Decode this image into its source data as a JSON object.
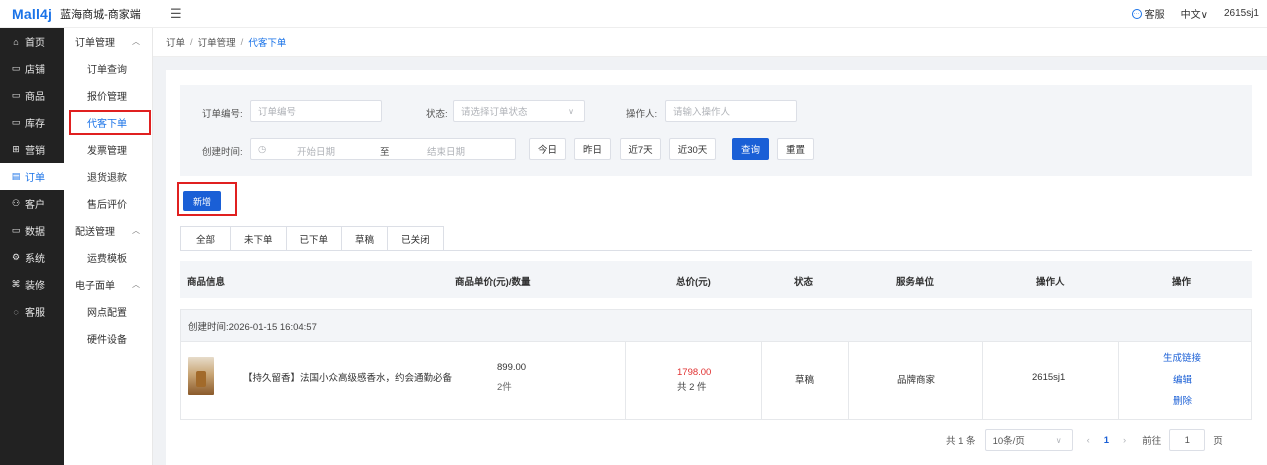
{
  "topbar": {
    "logo": "Mall4j",
    "app_title": "蓝海商城-商家端",
    "menu_toggle_icon": "menu-fold-icon",
    "service_label": "客服",
    "language_label": "中文∨",
    "user_name": "2615sj1"
  },
  "sidebar": {
    "items": [
      {
        "label": "首页",
        "icon": "home-icon"
      },
      {
        "label": "店铺",
        "icon": "shop-icon"
      },
      {
        "label": "商品",
        "icon": "goods-icon"
      },
      {
        "label": "库存",
        "icon": "stock-icon"
      },
      {
        "label": "营销",
        "icon": "gift-icon"
      },
      {
        "label": "订单",
        "icon": "order-icon"
      },
      {
        "label": "客户",
        "icon": "customer-icon"
      },
      {
        "label": "数据",
        "icon": "data-icon"
      },
      {
        "label": "系统",
        "icon": "system-icon"
      },
      {
        "label": "装修",
        "icon": "decorate-icon"
      },
      {
        "label": "客服",
        "icon": "chat-icon"
      }
    ],
    "glyphs": [
      "⌂",
      "▭",
      "▭",
      "▭",
      "⊞",
      "▤",
      "⚇",
      "▭",
      "⚙",
      "⌘",
      "◌"
    ]
  },
  "submenu": {
    "group1": "订单管理",
    "items1": [
      "订单查询",
      "报价管理",
      "代客下单",
      "发票管理",
      "退货退款",
      "售后评价"
    ],
    "group2": "配送管理",
    "items2": [
      "运费模板"
    ],
    "group3": "电子面单",
    "items3": [
      "网点配置",
      "硬件设备"
    ]
  },
  "breadcrumb": {
    "level1": "订单",
    "level2": "订单管理",
    "current": "代客下单",
    "separator": "/"
  },
  "filter": {
    "order_no_label": "订单编号:",
    "order_no_placeholder": "订单编号",
    "status_label": "状态:",
    "status_placeholder": "请选择订单状态",
    "operator_label": "操作人:",
    "operator_placeholder": "请输入操作人",
    "created_label": "创建时间:",
    "start_placeholder": "开始日期",
    "range_sep": "至",
    "end_placeholder": "结束日期",
    "quick_buttons": [
      "今日",
      "昨日",
      "近7天",
      "近30天"
    ],
    "search_button": "查询",
    "reset_button": "重置"
  },
  "actions": {
    "new_button": "新增"
  },
  "tabs": [
    "全部",
    "未下单",
    "已下单",
    "草稿",
    "已关闭"
  ],
  "table": {
    "headers": [
      "商品信息",
      "商品单价(元)/数量",
      "总价(元)",
      "状态",
      "服务单位",
      "操作人",
      "操作"
    ]
  },
  "order": {
    "created": "创建时间:2026-01-15 16:04:57",
    "product_name": "【持久留香】法国小众高级感香水，约会通勤必备",
    "unit_price": "899.00",
    "quantity": "2件",
    "total_price": "1798.00",
    "total_count": "共 2 件",
    "status": "草稿",
    "service_unit": "品牌商家",
    "operator": "2615sj1",
    "actions": [
      "生成链接",
      "编辑",
      "删除"
    ]
  },
  "pagination": {
    "total": "共 1 条",
    "page_size": "10条/页",
    "current_page": "1",
    "goto_label": "前往",
    "goto_value": "1",
    "page_suffix": "页"
  },
  "colors": {
    "primary": "#1a5fd6",
    "highlight_box": "#e02020",
    "price_red": "#e03030",
    "sidebar_bg": "#222222"
  }
}
